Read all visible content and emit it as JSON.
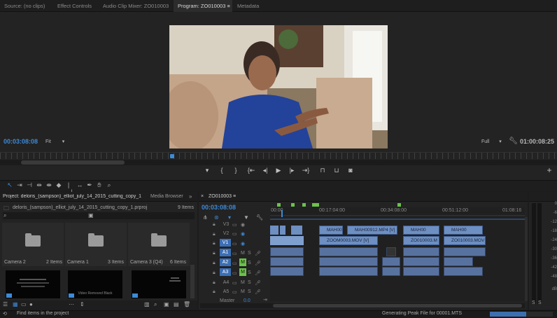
{
  "tabs": [
    {
      "label": "Source: (no clips)"
    },
    {
      "label": "Effect Controls"
    },
    {
      "label": "Audio Clip Mixer: ZO010003"
    },
    {
      "label": "Program: ZO010003",
      "active": true,
      "suffix": "≡"
    },
    {
      "label": "Metadata"
    }
  ],
  "program": {
    "current_time": "00:03:08:08",
    "fit": "Fit",
    "quality": "Full",
    "duration": "01:00:08:25"
  },
  "transport": {
    "icons": [
      "marker",
      "mark-in",
      "mark-out",
      "go-to-in",
      "step-back",
      "play",
      "step-forward",
      "go-to-out",
      "lift",
      "extract",
      "export-frame",
      "add"
    ]
  },
  "project": {
    "tab_label": "Project: deloris_(sampson)_elliot_july_14_2015_cutting_copy_1",
    "tab_suffix": "≡",
    "media_browser": "Media Browser",
    "more": "»",
    "file_name": "deloris_(sampson)_elliot_july_14_2015_cutting_copy_1.prproj",
    "item_count": "9 Items",
    "bins": [
      {
        "name": "Camera 2",
        "count": "2 Items"
      },
      {
        "name": "Camera 1",
        "count": "3 Items"
      },
      {
        "name": "Camera 3 (Q4)",
        "count": "6 Items"
      }
    ],
    "thumbs": [
      {
        "caption": ""
      },
      {
        "caption": "Video Removed Black"
      },
      {
        "caption": ""
      }
    ]
  },
  "timeline": {
    "seq_name": "ZO010003",
    "seq_suffix": "≡",
    "time": "00:03:08:08",
    "ruler": [
      "00:00",
      "00:17:04:00",
      "00:34:08:00",
      "00:51:12:00",
      "01:08:16"
    ],
    "video_tracks": [
      "V3",
      "V2",
      "V1"
    ],
    "audio_tracks": [
      "A1",
      "A2",
      "A3",
      "A4",
      "A5"
    ],
    "master_label": "Master",
    "master_value": "0.0",
    "v2_clips": [
      "MAH00",
      "MAH00912.MP4 [V]",
      "MAH00",
      "MAH00"
    ],
    "v1_clips": [
      "ZOOM0003.MOV [V]",
      "ZO010003.M",
      "ZO010003.MOV"
    ]
  },
  "meter": {
    "labels": [
      "0",
      "-6",
      "-12",
      "-18",
      "-24",
      "-30",
      "-36",
      "-42",
      "-48",
      "dB"
    ],
    "solo": "S"
  },
  "status": {
    "left": "Find items in the project",
    "center": "Generating Peak File for 00001.MTS"
  },
  "colors": {
    "accent": "#3c8ad8",
    "video_clip": "#6d8fc2",
    "audio_clip": "#5872a0",
    "selected_track": "#3b6fb6",
    "sync_green": "#6cc24a"
  }
}
